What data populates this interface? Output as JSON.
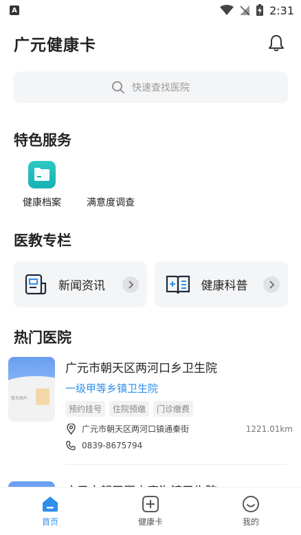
{
  "status": {
    "time": "2:31",
    "left_badge": "A"
  },
  "header": {
    "title": "广元健康卡"
  },
  "search": {
    "placeholder": "快速查找医院"
  },
  "services": {
    "title": "特色服务",
    "items": [
      {
        "label": "健康档案",
        "icon": "health-record-icon"
      },
      {
        "label": "满意度调查",
        "icon": ""
      }
    ]
  },
  "columns": {
    "title": "医教专栏",
    "items": [
      {
        "label": "新闻资讯",
        "icon": "news-icon"
      },
      {
        "label": "健康科普",
        "icon": "health-science-icon"
      }
    ]
  },
  "hospitals": {
    "title": "热门医院",
    "items": [
      {
        "name": "广元市朝天区两河口乡卫生院",
        "level": "一级甲等乡镇卫生院",
        "tags": [
          "预约挂号",
          "住院预缴",
          "门诊缴费"
        ],
        "address": "广元市朝天区两河口镇通秦街",
        "distance": "1221.01km",
        "phone": "0839-8675794",
        "thumb_text": "暂无图片"
      },
      {
        "name": "广元市朝天区水磨沟镇卫生院"
      }
    ]
  },
  "tabs": [
    {
      "label": "首页",
      "icon": "home-icon",
      "active": true
    },
    {
      "label": "健康卡",
      "icon": "health-card-icon",
      "active": false
    },
    {
      "label": "我的",
      "icon": "profile-icon",
      "active": false
    }
  ],
  "colors": {
    "accent": "#2f8fe8",
    "teal": "#14b3b1"
  }
}
